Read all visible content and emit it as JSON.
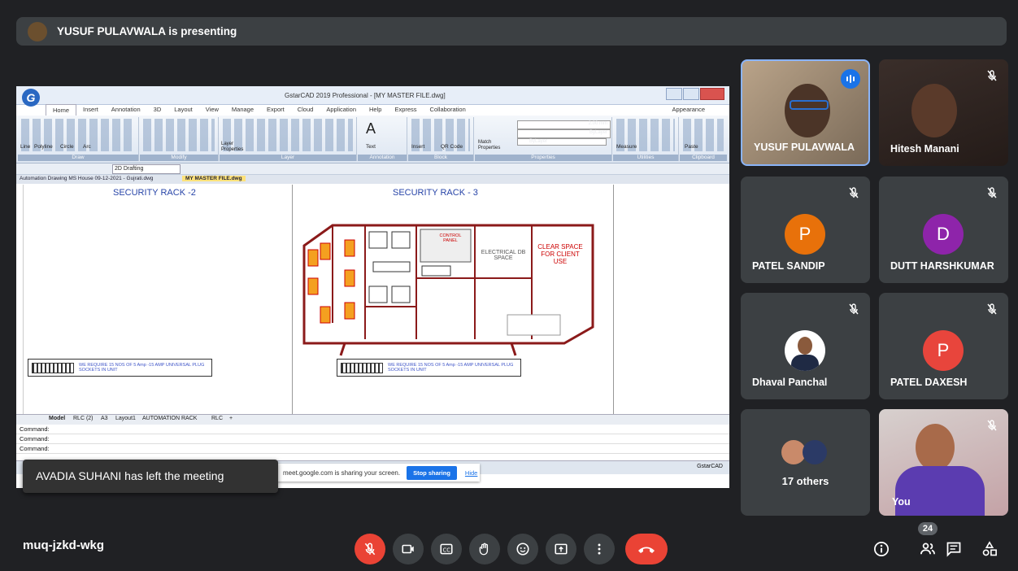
{
  "presenting_banner": {
    "text": "YUSUF PULAVWALA is presenting"
  },
  "shared_screen": {
    "window_title": "GstarCAD 2019 Professional - [MY MASTER FILE.dwg]",
    "ribbon_tabs": [
      "Home",
      "Insert",
      "Annotation",
      "3D",
      "Layout",
      "View",
      "Manage",
      "Export",
      "Cloud",
      "Application",
      "Help",
      "Express",
      "Collaboration"
    ],
    "appearance": "Appearance",
    "ribbon_groups": [
      "Draw",
      "Modify",
      "Layer",
      "Annotation",
      "Block",
      "Properties",
      "Utilities",
      "Clipboard"
    ],
    "tool_labels": {
      "line": "Line",
      "polyline": "Polyline",
      "circle": "Circle",
      "arc": "Arc",
      "layer_properties": "Layer Properties",
      "text": "Text",
      "insert": "Insert",
      "qr_code": "QR Code",
      "match_properties": "Match Properties",
      "measure": "Measure",
      "paste": "Paste",
      "lineweight": "2.00 mm",
      "bylayer1": "ByLayer",
      "bylayer2": "ByLayer"
    },
    "workspace": "2D Drafting",
    "file_tabs": [
      "Automation Drawing MS House 09-12-2021 - Gujrati.dwg",
      "MY MASTER FILE.dwg"
    ],
    "rack_titles": [
      "SECURITY RACK -2",
      "SECURITY RACK - 3"
    ],
    "rack_labels": {
      "control_panel": "CONTROL PANEL",
      "electrical": "ELECTRICAL DB SPACE",
      "clear_space": "CLEAR SPACE FOR CLIENT USE"
    },
    "notes": [
      "WE REQUIRE 15 NOS OF 5 Amp -15 AMP UNIVERSAL PLUG SOCKETS IN UNIT",
      "WE REQUIRE 15 NOS OF 5 Amp -15 AMP UNIVERSAL PLUG SOCKETS IN UNIT"
    ],
    "sheet_tabs": [
      "Model",
      "RLC (2)",
      "A3",
      "Layout1",
      "AUTOMATION RACK",
      "RLC",
      "+"
    ],
    "command_lines": [
      "Command:",
      "Command:",
      "Command:"
    ],
    "status_brand": "GstarCAD",
    "share_bar": {
      "message": "meet.google.com is sharing your screen.",
      "stop": "Stop sharing",
      "hide": "Hide"
    }
  },
  "toast": {
    "text": "AVADIA SUHANI has left the meeting"
  },
  "participants": [
    {
      "name": "YUSUF PULAVWALA",
      "type": "video",
      "speaking": true
    },
    {
      "name": "Hitesh Manani",
      "type": "video",
      "muted": true
    },
    {
      "name": "PATEL SANDIP",
      "initial": "P",
      "color": "#e8710a",
      "muted": true
    },
    {
      "name": "DUTT HARSHKUMAR",
      "initial": "D",
      "color": "#8e24aa",
      "muted": true
    },
    {
      "name": "Dhaval Panchal",
      "type": "photo",
      "muted": true
    },
    {
      "name": "PATEL DAXESH",
      "initial": "P",
      "color": "#e8453c",
      "muted": true
    },
    {
      "name": "You",
      "type": "video",
      "muted": true
    }
  ],
  "others": {
    "label": "17 others"
  },
  "bottom_bar": {
    "meeting_code": "muq-jzkd-wkg",
    "controls": [
      "mic-off",
      "camera",
      "captions",
      "raise-hand",
      "emoji",
      "present",
      "more",
      "end-call"
    ],
    "participant_count": "24"
  },
  "colors": {
    "background": "#202124",
    "tile": "#3c4043",
    "danger": "#ea4335",
    "accent": "#1a73e8"
  }
}
